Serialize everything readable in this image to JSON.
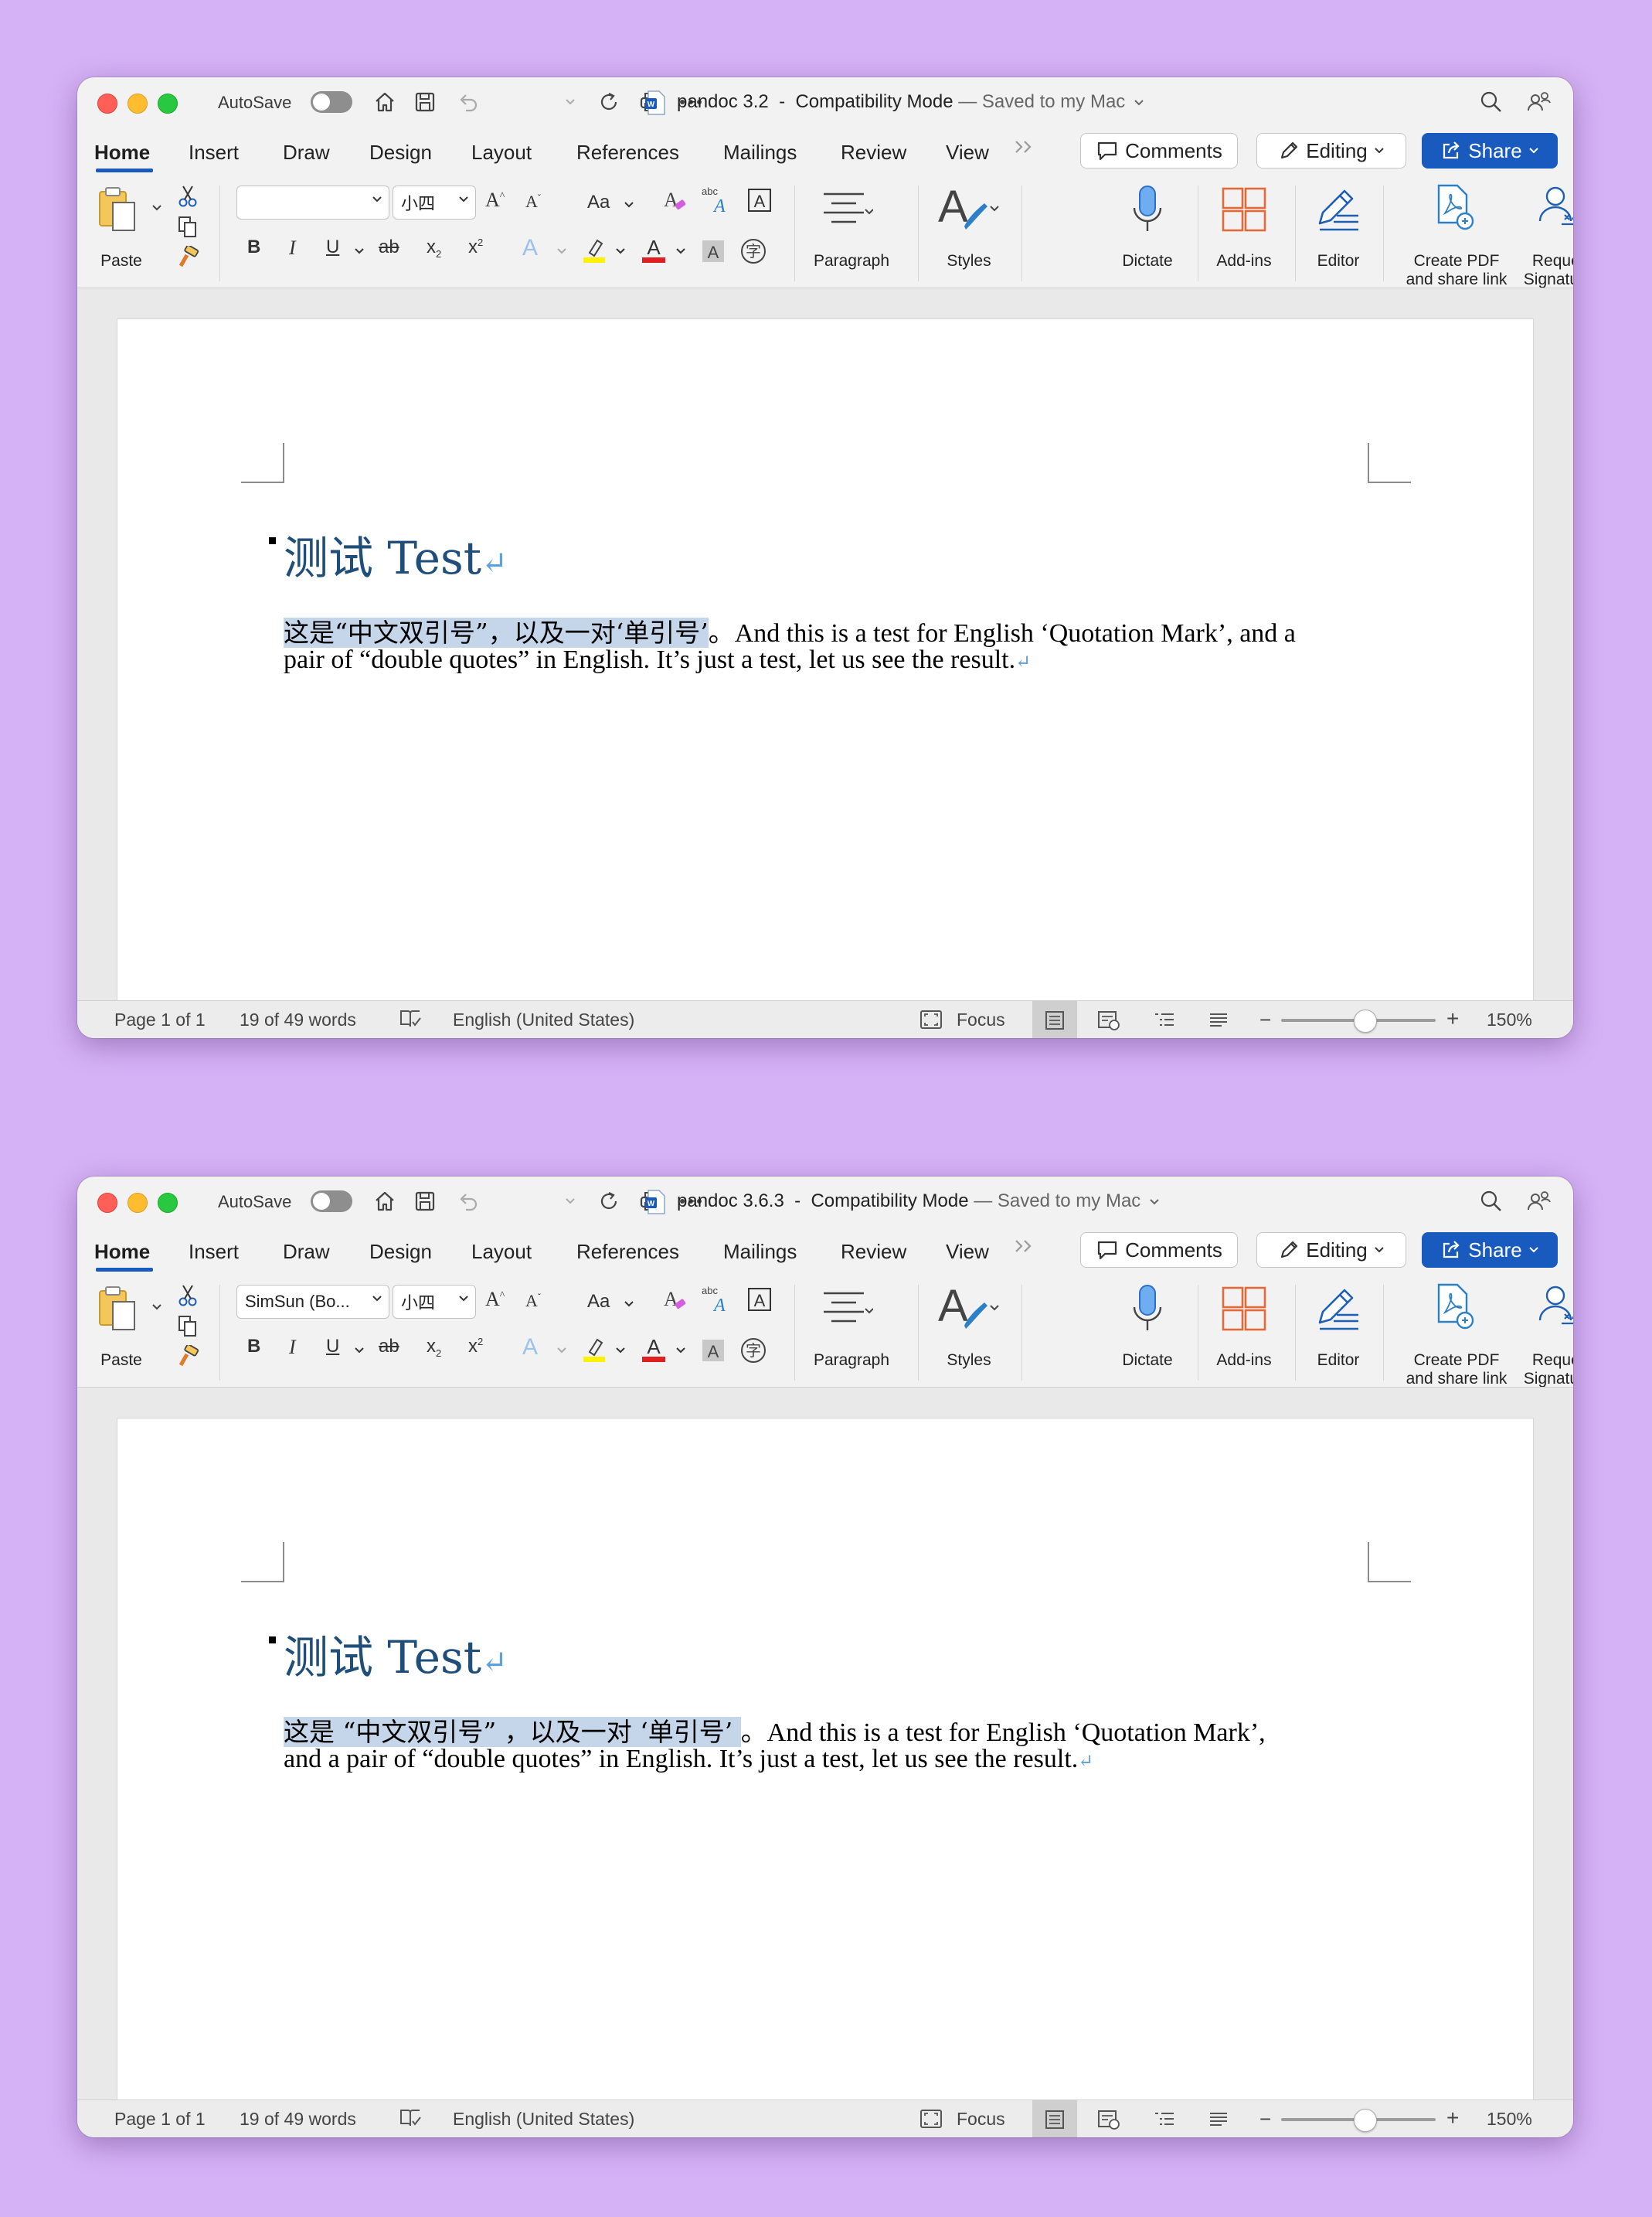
{
  "windows": [
    {
      "autosave_label": "AutoSave",
      "doc_name": "pandoc 3.2",
      "title_sep": "  -  ",
      "mode": "Compatibility Mode",
      "saved_status": " — Saved to my Mac",
      "tabs": [
        "Home",
        "Insert",
        "Draw",
        "Design",
        "Layout",
        "References",
        "Mailings",
        "Review",
        "View"
      ],
      "comments_label": "Comments",
      "editing_label": "Editing",
      "share_label": "Share",
      "font_name": "",
      "font_size": "小四",
      "ribbon": {
        "paste": "Paste",
        "paragraph": "Paragraph",
        "styles": "Styles",
        "dictate": "Dictate",
        "addins": "Add-ins",
        "editor": "Editor",
        "create_pdf_1": "Create PDF",
        "create_pdf_2": "and share link",
        "request_1": "Request",
        "request_2": "Signatures"
      },
      "heading": "测试 Test",
      "line1_highlight": "这是“中文双引号”，以及一对‘单引号’",
      "line1_rest": "。And this is a test for English ‘Quotation Mark’, and a",
      "line2": "pair of “double quotes” in English. It’s just a test, let us see the result.",
      "status": {
        "page": "Page 1 of 1",
        "words": "19 of 49 words",
        "language": "English (United States)",
        "focus": "Focus",
        "zoom": "150%"
      }
    },
    {
      "autosave_label": "AutoSave",
      "doc_name": "pandoc 3.6.3",
      "title_sep": "  -  ",
      "mode": "Compatibility Mode",
      "saved_status": " — Saved to my Mac",
      "tabs": [
        "Home",
        "Insert",
        "Draw",
        "Design",
        "Layout",
        "References",
        "Mailings",
        "Review",
        "View"
      ],
      "comments_label": "Comments",
      "editing_label": "Editing",
      "share_label": "Share",
      "font_name": "SimSun (Bo...",
      "font_size": "小四",
      "ribbon": {
        "paste": "Paste",
        "paragraph": "Paragraph",
        "styles": "Styles",
        "dictate": "Dictate",
        "addins": "Add-ins",
        "editor": "Editor",
        "create_pdf_1": "Create PDF",
        "create_pdf_2": "and share link",
        "request_1": "Request",
        "request_2": "Signatures"
      },
      "heading": "测试 Test",
      "line1_highlight": "这是 “中文双引号” ，以及一对 ‘单引号’ ",
      "line1_rest": "。And this is a test for English ‘Quotation Mark’,",
      "line2": "and a pair of “double quotes” in English. It’s just a test, let us see the result.",
      "status": {
        "page": "Page 1 of 1",
        "words": "19 of 49 words",
        "language": "English (United States)",
        "focus": "Focus",
        "zoom": "150%"
      }
    }
  ],
  "colors": {
    "background": "#d5b1f5",
    "accent": "#185abd",
    "heading": "#1e4e79",
    "highlight": "#c5d6ea"
  }
}
